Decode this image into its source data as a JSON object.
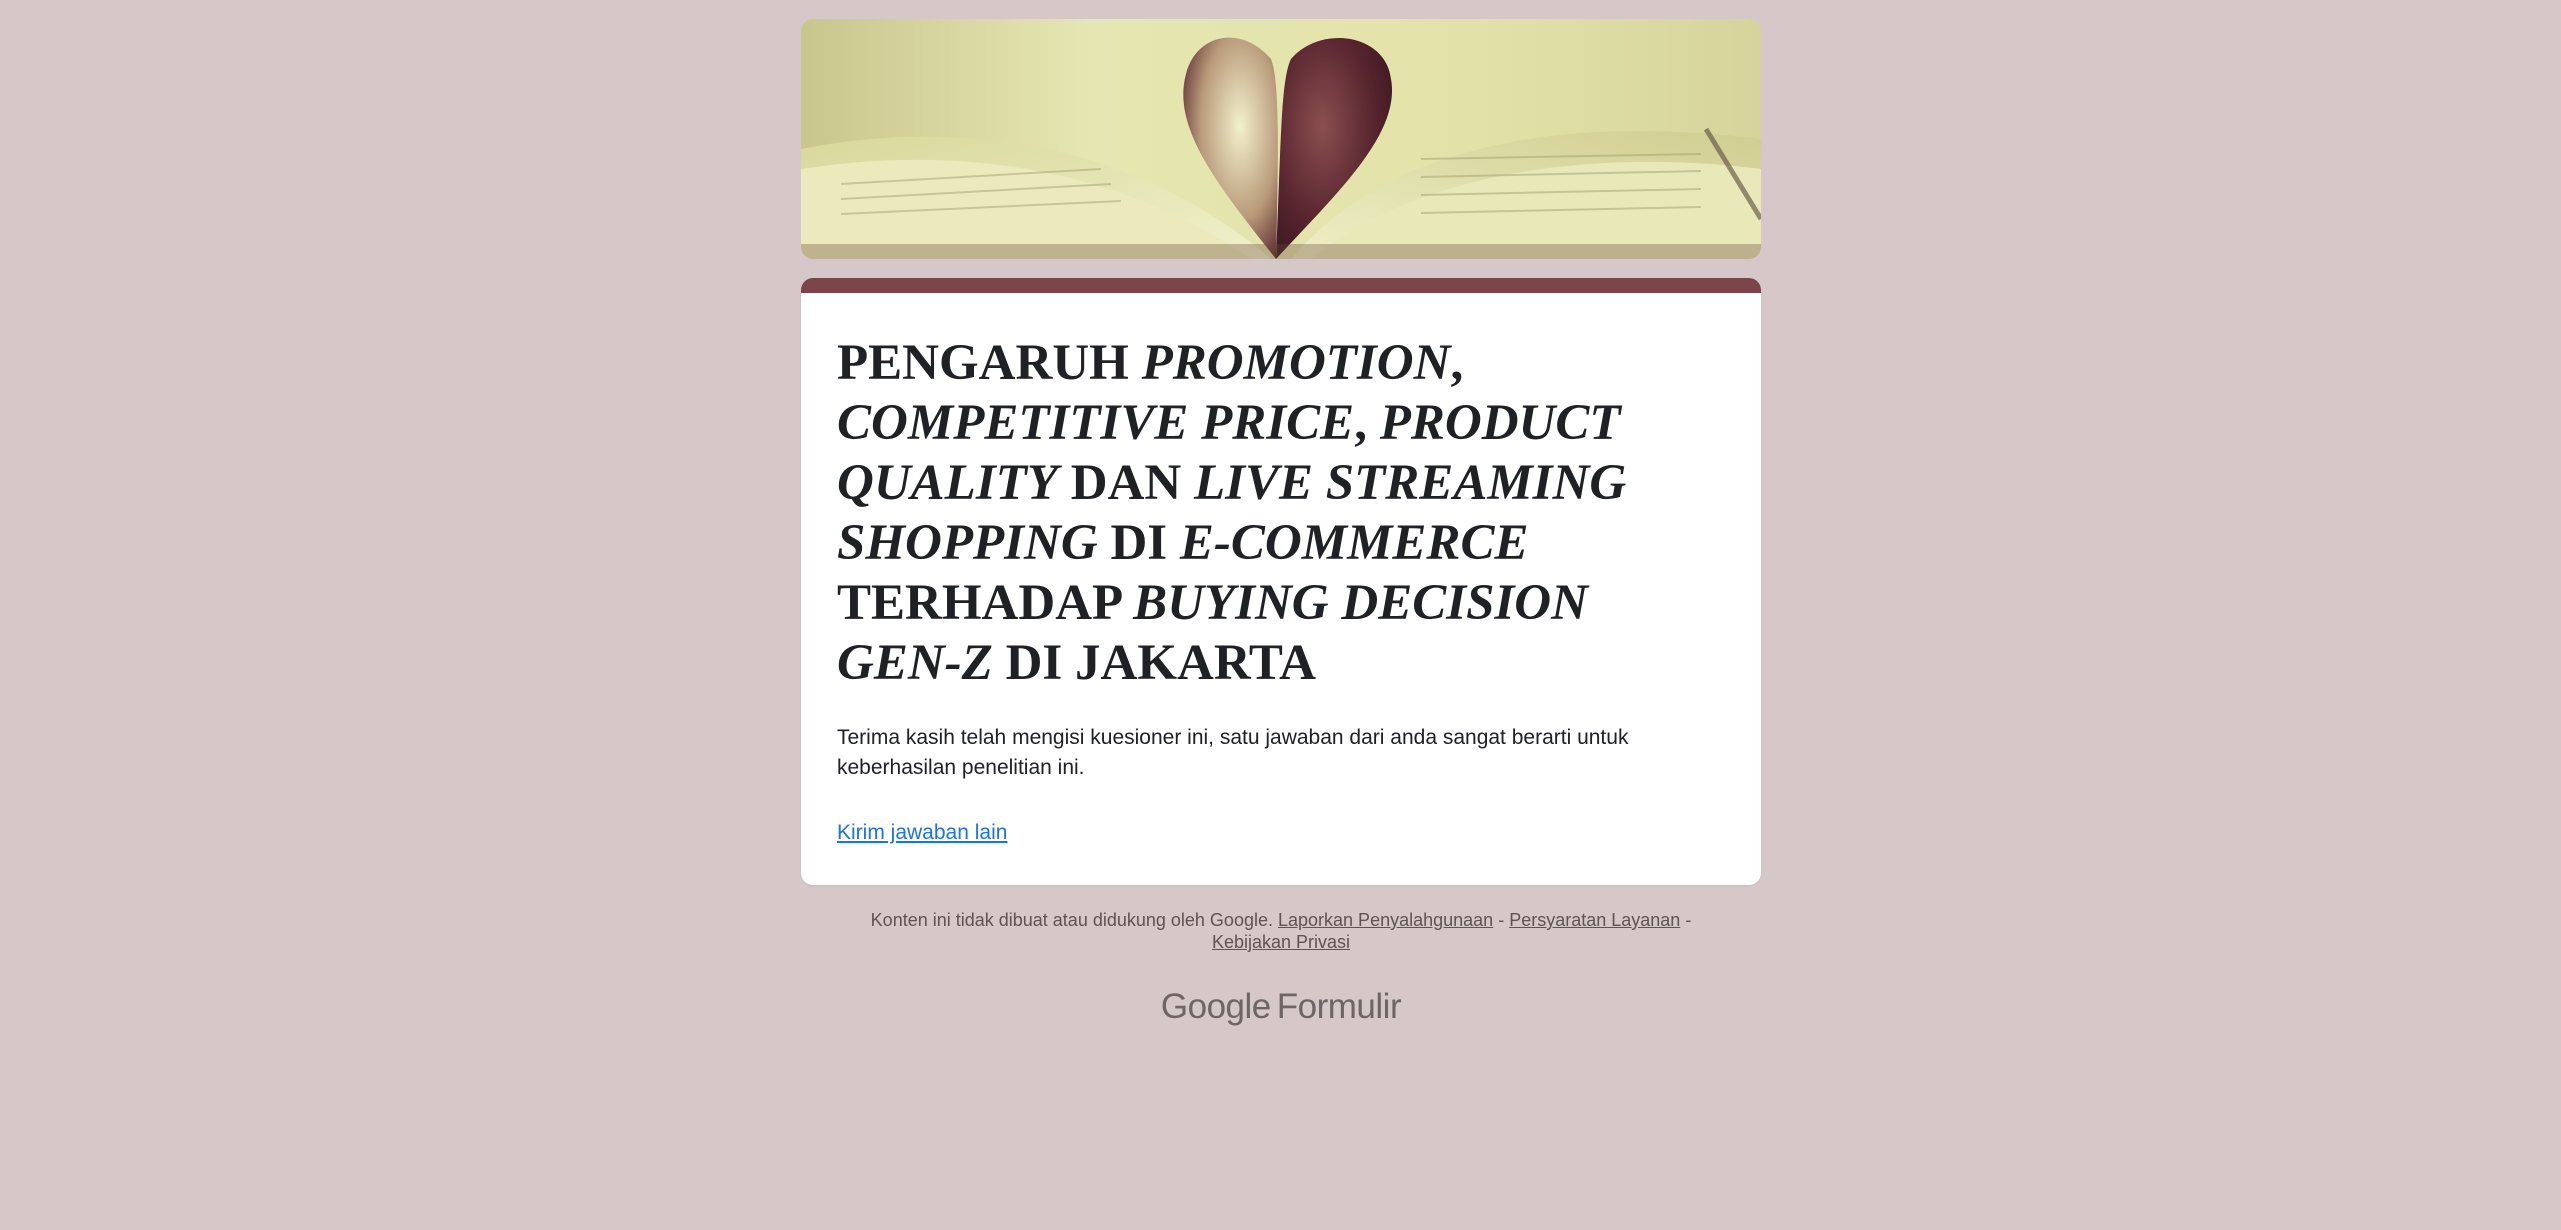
{
  "header": {
    "banner_image": "open-book-heart-pages"
  },
  "form": {
    "title_parts": {
      "p1": "PENGARUH ",
      "p2": "PROMOTION",
      "p3": ", ",
      "p4": "COMPETITIVE PRICE",
      "p5": ", ",
      "p6": "PRODUCT QUALITY",
      "p7": " DAN ",
      "p8": "LIVE STREAMING SHOPPING",
      "p9": " DI ",
      "p10": "E-COMMERCE",
      "p11": " TERHADAP ",
      "p12": "BUYING DECISION GEN-Z",
      "p13": " DI JAKARTA"
    },
    "confirmation_message": "Terima kasih telah mengisi kuesioner ini, satu jawaban dari anda sangat berarti untuk keberhasilan penelitian ini.",
    "submit_another_label": "Kirim jawaban lain"
  },
  "footer": {
    "disclaimer": "Konten ini tidak dibuat atau didukung oleh Google.",
    "report_abuse": "Laporkan Penyalahgunaan",
    "separator": " - ",
    "terms": "Persyaratan Layanan",
    "privacy": "Kebijakan Privasi"
  },
  "brand": {
    "google": "Google",
    "product": "Formulir"
  },
  "colors": {
    "background": "#d6c7c8",
    "accent": "#7a4548",
    "link": "#1a73e8",
    "text": "#202124"
  }
}
